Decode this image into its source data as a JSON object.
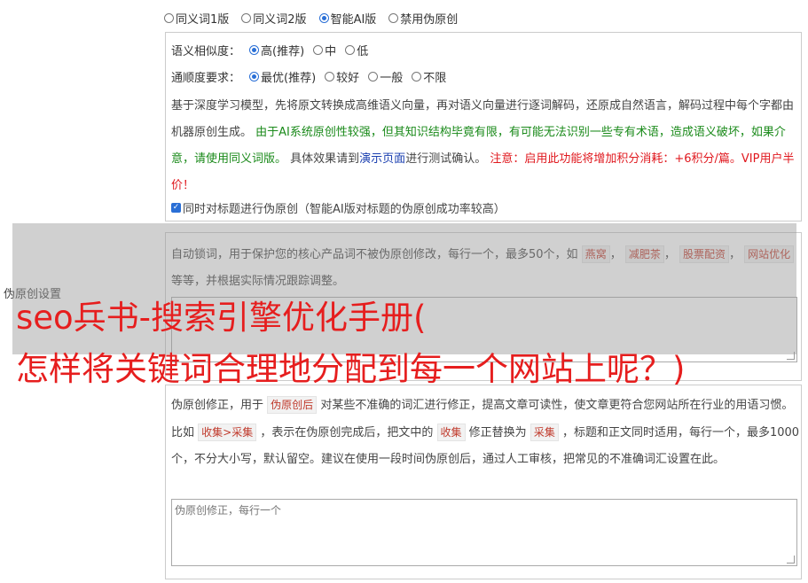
{
  "version_options": [
    {
      "label": "同义词1版",
      "selected": false
    },
    {
      "label": "同义词2版",
      "selected": false
    },
    {
      "label": "智能AI版",
      "selected": true
    },
    {
      "label": "禁用伪原创",
      "selected": false
    }
  ],
  "similarity": {
    "label": "语义相似度：",
    "options": [
      {
        "label": "高(推荐)",
        "selected": true
      },
      {
        "label": "中",
        "selected": false
      },
      {
        "label": "低",
        "selected": false
      }
    ]
  },
  "fluency": {
    "label": "通顺度要求：",
    "options": [
      {
        "label": "最优(推荐)",
        "selected": true
      },
      {
        "label": "较好",
        "selected": false
      },
      {
        "label": "一般",
        "selected": false
      },
      {
        "label": "不限",
        "selected": false
      }
    ]
  },
  "ai_description": {
    "part1": "基于深度学习模型，先将原文转换成高维语义向量，再对语义向量进行逐词解码，还原成自然语言，解码过程中每个字都由机器原创生成。",
    "part2_green": "由于AI系统原创性较强，但其知识结构毕竟有限，有可能无法识别一些专有术语，造成语义破坏，如果介意，请使用同义词版。",
    "part3": "具体效果请到",
    "link": "演示页面",
    "part4": "进行测试确认。",
    "warning_red": "注意：启用此功能将增加积分消耗：+6积分/篇。VIP用户半价！"
  },
  "title_checkbox": {
    "label": "同时对标题进行伪原创（智能AI版对标题的伪原创成功率较高）",
    "checked": true
  },
  "section_label": "伪原创设置",
  "lock_words": {
    "text1": "自动锁词，用于保护您的核心产品词不被伪原创修改，每行一个，最多50个，如",
    "tags": [
      "燕窝",
      "减肥茶",
      "股票配资",
      "网站优化"
    ],
    "text2": "等等，并根据实际情况跟踪调整。"
  },
  "banner": {
    "line1": "seo兵书-搜索引擎优化手册(",
    "line2": "怎样将关键词合理地分配到每一个网站上呢？)"
  },
  "correction": {
    "t1": "伪原创修正，用于",
    "tag1": "伪原创后",
    "t2": "对某些不准确的词汇进行修正，提高文章可读性，使文章更符合您网站所在行业的用语习惯。比如",
    "tag2": "收集>采集",
    "t3": "，表示在伪原创完成后，把文中的",
    "tag3": "收集",
    "t4": "修正替换为",
    "tag4": "采集",
    "t5": "，标题和正文同时适用，每行一个，最多1000个，不分大小写，默认留空。建议在使用一段时间伪原创后，通过人工审核，把常见的不准确词汇设置在此。",
    "placeholder": "伪原创修正，每行一个"
  }
}
